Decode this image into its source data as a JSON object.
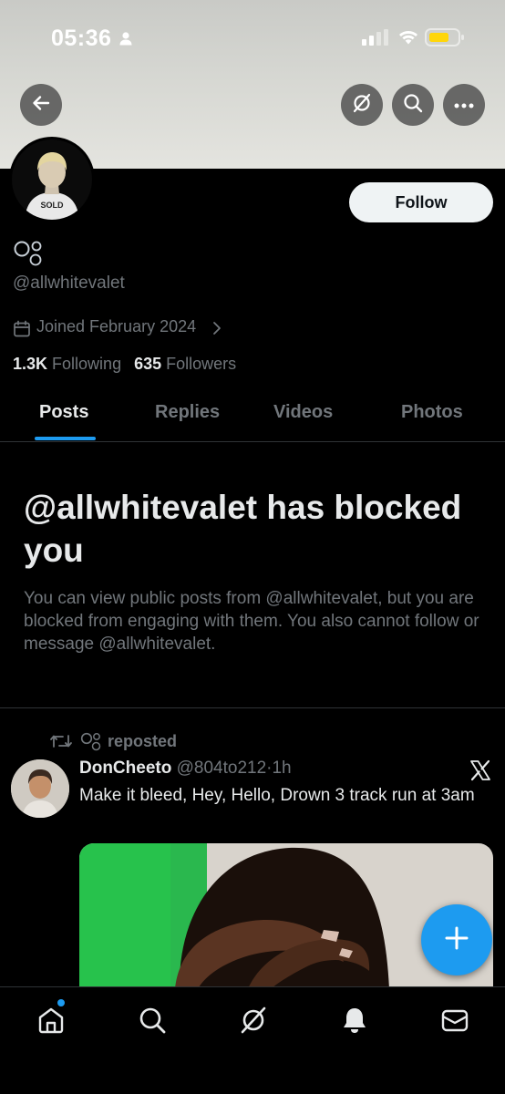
{
  "status_bar": {
    "time": "05:36"
  },
  "profile": {
    "handle": "@allwhitevalet",
    "joined": "Joined February 2024",
    "following_count": "1.3K",
    "following_label": "Following",
    "followers_count": "635",
    "followers_label": "Followers",
    "follow_button": "Follow",
    "avatar_shirt_text": "SOLD"
  },
  "tabs": [
    {
      "label": "Posts",
      "active": true
    },
    {
      "label": "Replies",
      "active": false
    },
    {
      "label": "Videos",
      "active": false
    },
    {
      "label": "Photos",
      "active": false
    }
  ],
  "blocked": {
    "title": "@allwhitevalet has blocked you",
    "description": "You can view public posts from @allwhitevalet, but you are blocked from engaging with them. You also cannot follow or message @allwhitevalet."
  },
  "post": {
    "repost_label": "reposted",
    "author_name": "DonCheeto",
    "author_handle": "@804to212",
    "separator": "·",
    "time": "1h",
    "text": "Make it bleed, Hey, Hello, Drown 3 track run at 3am"
  },
  "colors": {
    "accent": "#1d9bf0",
    "background": "#000000",
    "text_primary": "#e7e9ea",
    "text_secondary": "#71767b"
  },
  "icons": {
    "back": "arrow-left-icon",
    "grok": "grok-icon",
    "search": "search-icon",
    "more": "more-horizontal-icon",
    "home": "home-icon",
    "notifications": "bell-icon",
    "messages": "mail-icon",
    "compose": "plus-icon"
  }
}
